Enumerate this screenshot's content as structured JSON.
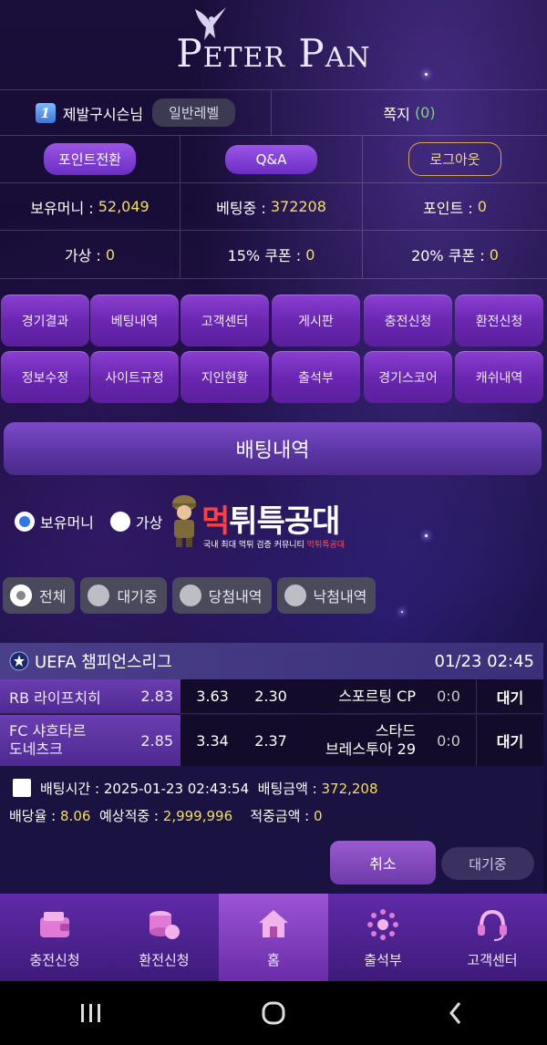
{
  "brand": {
    "name_first": "P",
    "name_first_rest": "ETER",
    "name_second": "P",
    "name_second_rest": "AN"
  },
  "user": {
    "level_number": "1",
    "name": "제발구시슨님",
    "level_label": "일반레벨",
    "messages_label": "쪽지",
    "messages_count": "(0)"
  },
  "actions": {
    "point_convert": "포인트전환",
    "qna": "Q&A",
    "logout": "로그아웃"
  },
  "balances": {
    "money_label": "보유머니 :",
    "money_value": "52,049",
    "betting_label": "베팅중 :",
    "betting_value": "372208",
    "point_label": "포인트 :",
    "point_value": "0",
    "virtual_label": "가상 :",
    "virtual_value": "0",
    "coupon15_label": "15% 쿠폰 :",
    "coupon15_value": "0",
    "coupon20_label": "20% 쿠폰 :",
    "coupon20_value": "0"
  },
  "menu": {
    "row1": [
      "경기결과",
      "베팅내역",
      "고객센터",
      "게시판",
      "충전신청",
      "환전신청"
    ],
    "row2": [
      "정보수정",
      "사이트규정",
      "지인현황",
      "출석부",
      "경기스코어",
      "캐쉬내역"
    ]
  },
  "section_title": "배팅내역",
  "wallet_filter": {
    "money": "보유머니",
    "virtual": "가상"
  },
  "watermark": {
    "title_a": "먹",
    "title_b": "튀",
    "title_c": "특공대",
    "sub_a": "국내 최대 먹튀 검증 커뮤니티 ",
    "sub_b": "먹튀특공대"
  },
  "filters": [
    "전체",
    "대기중",
    "당첨내역",
    "낙첨내역"
  ],
  "league": {
    "name": "UEFA 챔피언스리그",
    "datetime": "01/23 02:45"
  },
  "matches": [
    {
      "home": "RB 라이프치히",
      "home_odd": "2.83",
      "draw_odd": "3.63",
      "away_odd": "2.30",
      "away": "스포르팅 CP",
      "score": "0:0",
      "status": "대기"
    },
    {
      "home_l1": "FC 샤흐타르",
      "home_l2": "도네츠크",
      "home_odd": "2.85",
      "draw_odd": "3.34",
      "away_odd": "2.37",
      "away_l1": "스타드",
      "away_l2": "브레스투아 29",
      "score": "0:0",
      "status": "대기"
    }
  ],
  "bet": {
    "time_label": "배팅시간 :",
    "time_value": "2025-01-23 02:43:54",
    "amount_label": "배팅금액 :",
    "amount_value": "372,208",
    "rate_label": "배당율 :",
    "rate_value": "8.06",
    "expected_label": "예상적중 :",
    "expected_value": "2,999,996",
    "won_label": "적중금액 :",
    "won_value": "0",
    "cancel": "취소",
    "status": "대기중"
  },
  "bottom_nav": [
    "충전신청",
    "환전신청",
    "홈",
    "출석부",
    "고객센터"
  ]
}
